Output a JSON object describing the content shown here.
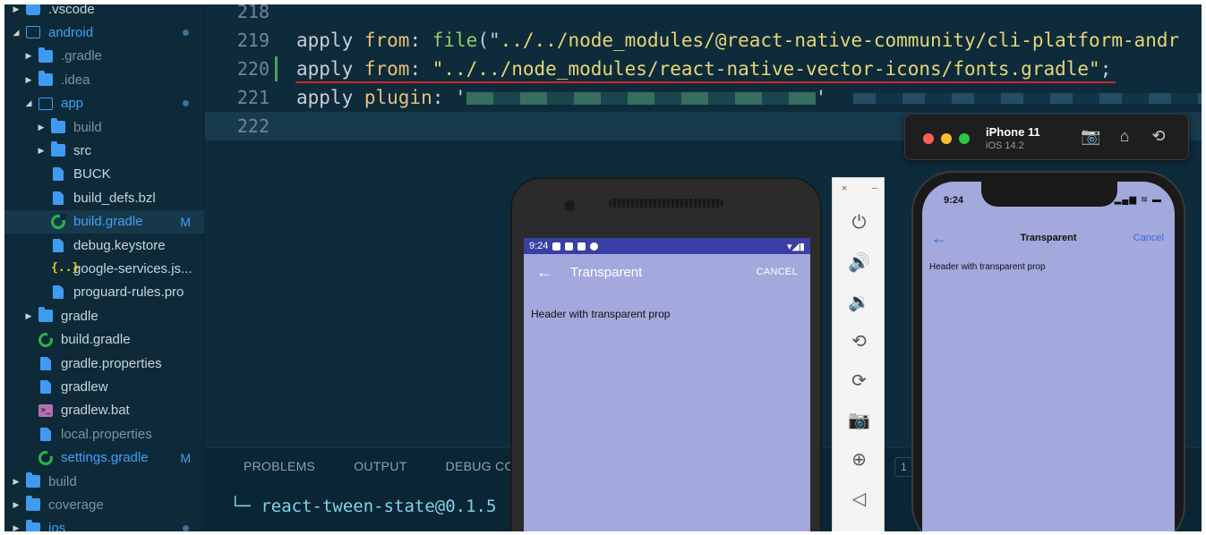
{
  "explorer": {
    "items": [
      {
        "label": ".vscode",
        "level": 0,
        "icon": "vscode-folder",
        "twisty": "closed"
      },
      {
        "label": "android",
        "level": 0,
        "icon": "folder-open",
        "twisty": "open",
        "dot": true,
        "style": "mod"
      },
      {
        "label": ".gradle",
        "level": 1,
        "icon": "folder",
        "twisty": "closed",
        "style": "dim"
      },
      {
        "label": ".idea",
        "level": 1,
        "icon": "folder",
        "twisty": "closed",
        "style": "dim"
      },
      {
        "label": "app",
        "level": 1,
        "icon": "folder-open",
        "twisty": "open",
        "dot": true,
        "style": "mod"
      },
      {
        "label": "build",
        "level": 2,
        "icon": "folder",
        "twisty": "closed",
        "style": "dim"
      },
      {
        "label": "src",
        "level": 2,
        "icon": "folder",
        "twisty": "closed"
      },
      {
        "label": "BUCK",
        "level": 2,
        "icon": "file"
      },
      {
        "label": "build_defs.bzl",
        "level": 2,
        "icon": "file"
      },
      {
        "label": "build.gradle",
        "level": 2,
        "icon": "gradle",
        "badge": "M",
        "style": "mod",
        "selected": true
      },
      {
        "label": "debug.keystore",
        "level": 2,
        "icon": "file"
      },
      {
        "label": "google-services.js...",
        "level": 2,
        "icon": "json"
      },
      {
        "label": "proguard-rules.pro",
        "level": 2,
        "icon": "file"
      },
      {
        "label": "gradle",
        "level": 1,
        "icon": "folder",
        "twisty": "closed"
      },
      {
        "label": "build.gradle",
        "level": 1,
        "icon": "gradle"
      },
      {
        "label": "gradle.properties",
        "level": 1,
        "icon": "file"
      },
      {
        "label": "gradlew",
        "level": 1,
        "icon": "file"
      },
      {
        "label": "gradlew.bat",
        "level": 1,
        "icon": "terminal"
      },
      {
        "label": "local.properties",
        "level": 1,
        "icon": "file",
        "style": "dim"
      },
      {
        "label": "settings.gradle",
        "level": 1,
        "icon": "gradle",
        "badge": "M",
        "style": "mod"
      },
      {
        "label": "build",
        "level": 0,
        "icon": "folder",
        "twisty": "closed",
        "style": "dim"
      },
      {
        "label": "coverage",
        "level": 0,
        "icon": "folder",
        "twisty": "closed",
        "style": "dim"
      },
      {
        "label": "ios",
        "level": 0,
        "icon": "folder",
        "twisty": "closed",
        "dot": true,
        "style": "mod"
      }
    ]
  },
  "editor": {
    "lines": [
      {
        "number": "218",
        "tokens": []
      },
      {
        "number": "219",
        "tokens": [
          {
            "t": "apply ",
            "c": "kw"
          },
          {
            "t": "from",
            "c": "kw2"
          },
          {
            "t": ": ",
            "c": "plain"
          },
          {
            "t": "file",
            "c": "fn"
          },
          {
            "t": "(\"",
            "c": "plain"
          },
          {
            "t": "../../node_modules/@react-native-community/cli-platform-andr",
            "c": "str"
          }
        ]
      },
      {
        "number": "220",
        "changed": true,
        "tokens": [
          {
            "t": "apply ",
            "c": "kw"
          },
          {
            "t": "from",
            "c": "kw2"
          },
          {
            "t": ": ",
            "c": "plain"
          },
          {
            "t": "\"../../node_modules/react-native-vector-icons/fonts.gradle\"",
            "c": "str"
          },
          {
            "t": ";",
            "c": "plain"
          }
        ]
      },
      {
        "number": "221",
        "tokens": [
          {
            "t": "apply ",
            "c": "kw"
          },
          {
            "t": "plugin",
            "c": "kw2"
          },
          {
            "t": ": '",
            "c": "plain"
          }
        ],
        "redacted": true
      },
      {
        "number": "222",
        "active": true,
        "tokens": []
      }
    ]
  },
  "panel": {
    "tabs": [
      "PROBLEMS",
      "OUTPUT",
      "DEBUG CO"
    ],
    "box_label": "1",
    "terminal_line": "└─ react-tween-state@0.1.5"
  },
  "android": {
    "status_time": "9:24",
    "header_title": "Transparent",
    "header_cancel": "CANCEL",
    "back_glyph": "←",
    "body_text": "Header with transparent prop"
  },
  "emulator_controls": {
    "close": "×",
    "minimize": "−",
    "buttons": [
      {
        "name": "power-icon",
        "glyph": "⏻"
      },
      {
        "name": "volume-up-icon",
        "glyph": "🔊"
      },
      {
        "name": "volume-down-icon",
        "glyph": "🔉"
      },
      {
        "name": "rotate-left-icon",
        "glyph": "⟲"
      },
      {
        "name": "rotate-right-icon",
        "glyph": "⟳"
      },
      {
        "name": "camera-icon",
        "glyph": "📷"
      },
      {
        "name": "zoom-icon",
        "glyph": "⊕"
      },
      {
        "name": "back-icon",
        "glyph": "◁"
      }
    ]
  },
  "ios": {
    "device_name": "iPhone 11",
    "os_version": "iOS 14.2",
    "status_time": "9:24",
    "status_icons": "▂▄▆ ≋ ▬",
    "header_title": "Transparent",
    "header_cancel": "Cancel",
    "back_glyph": "←",
    "body_text": "Header with transparent prop",
    "tools": [
      {
        "name": "screenshot-icon",
        "glyph": "📷"
      },
      {
        "name": "home-icon",
        "glyph": "⌂"
      },
      {
        "name": "rotate-icon",
        "glyph": "⟲"
      }
    ]
  }
}
